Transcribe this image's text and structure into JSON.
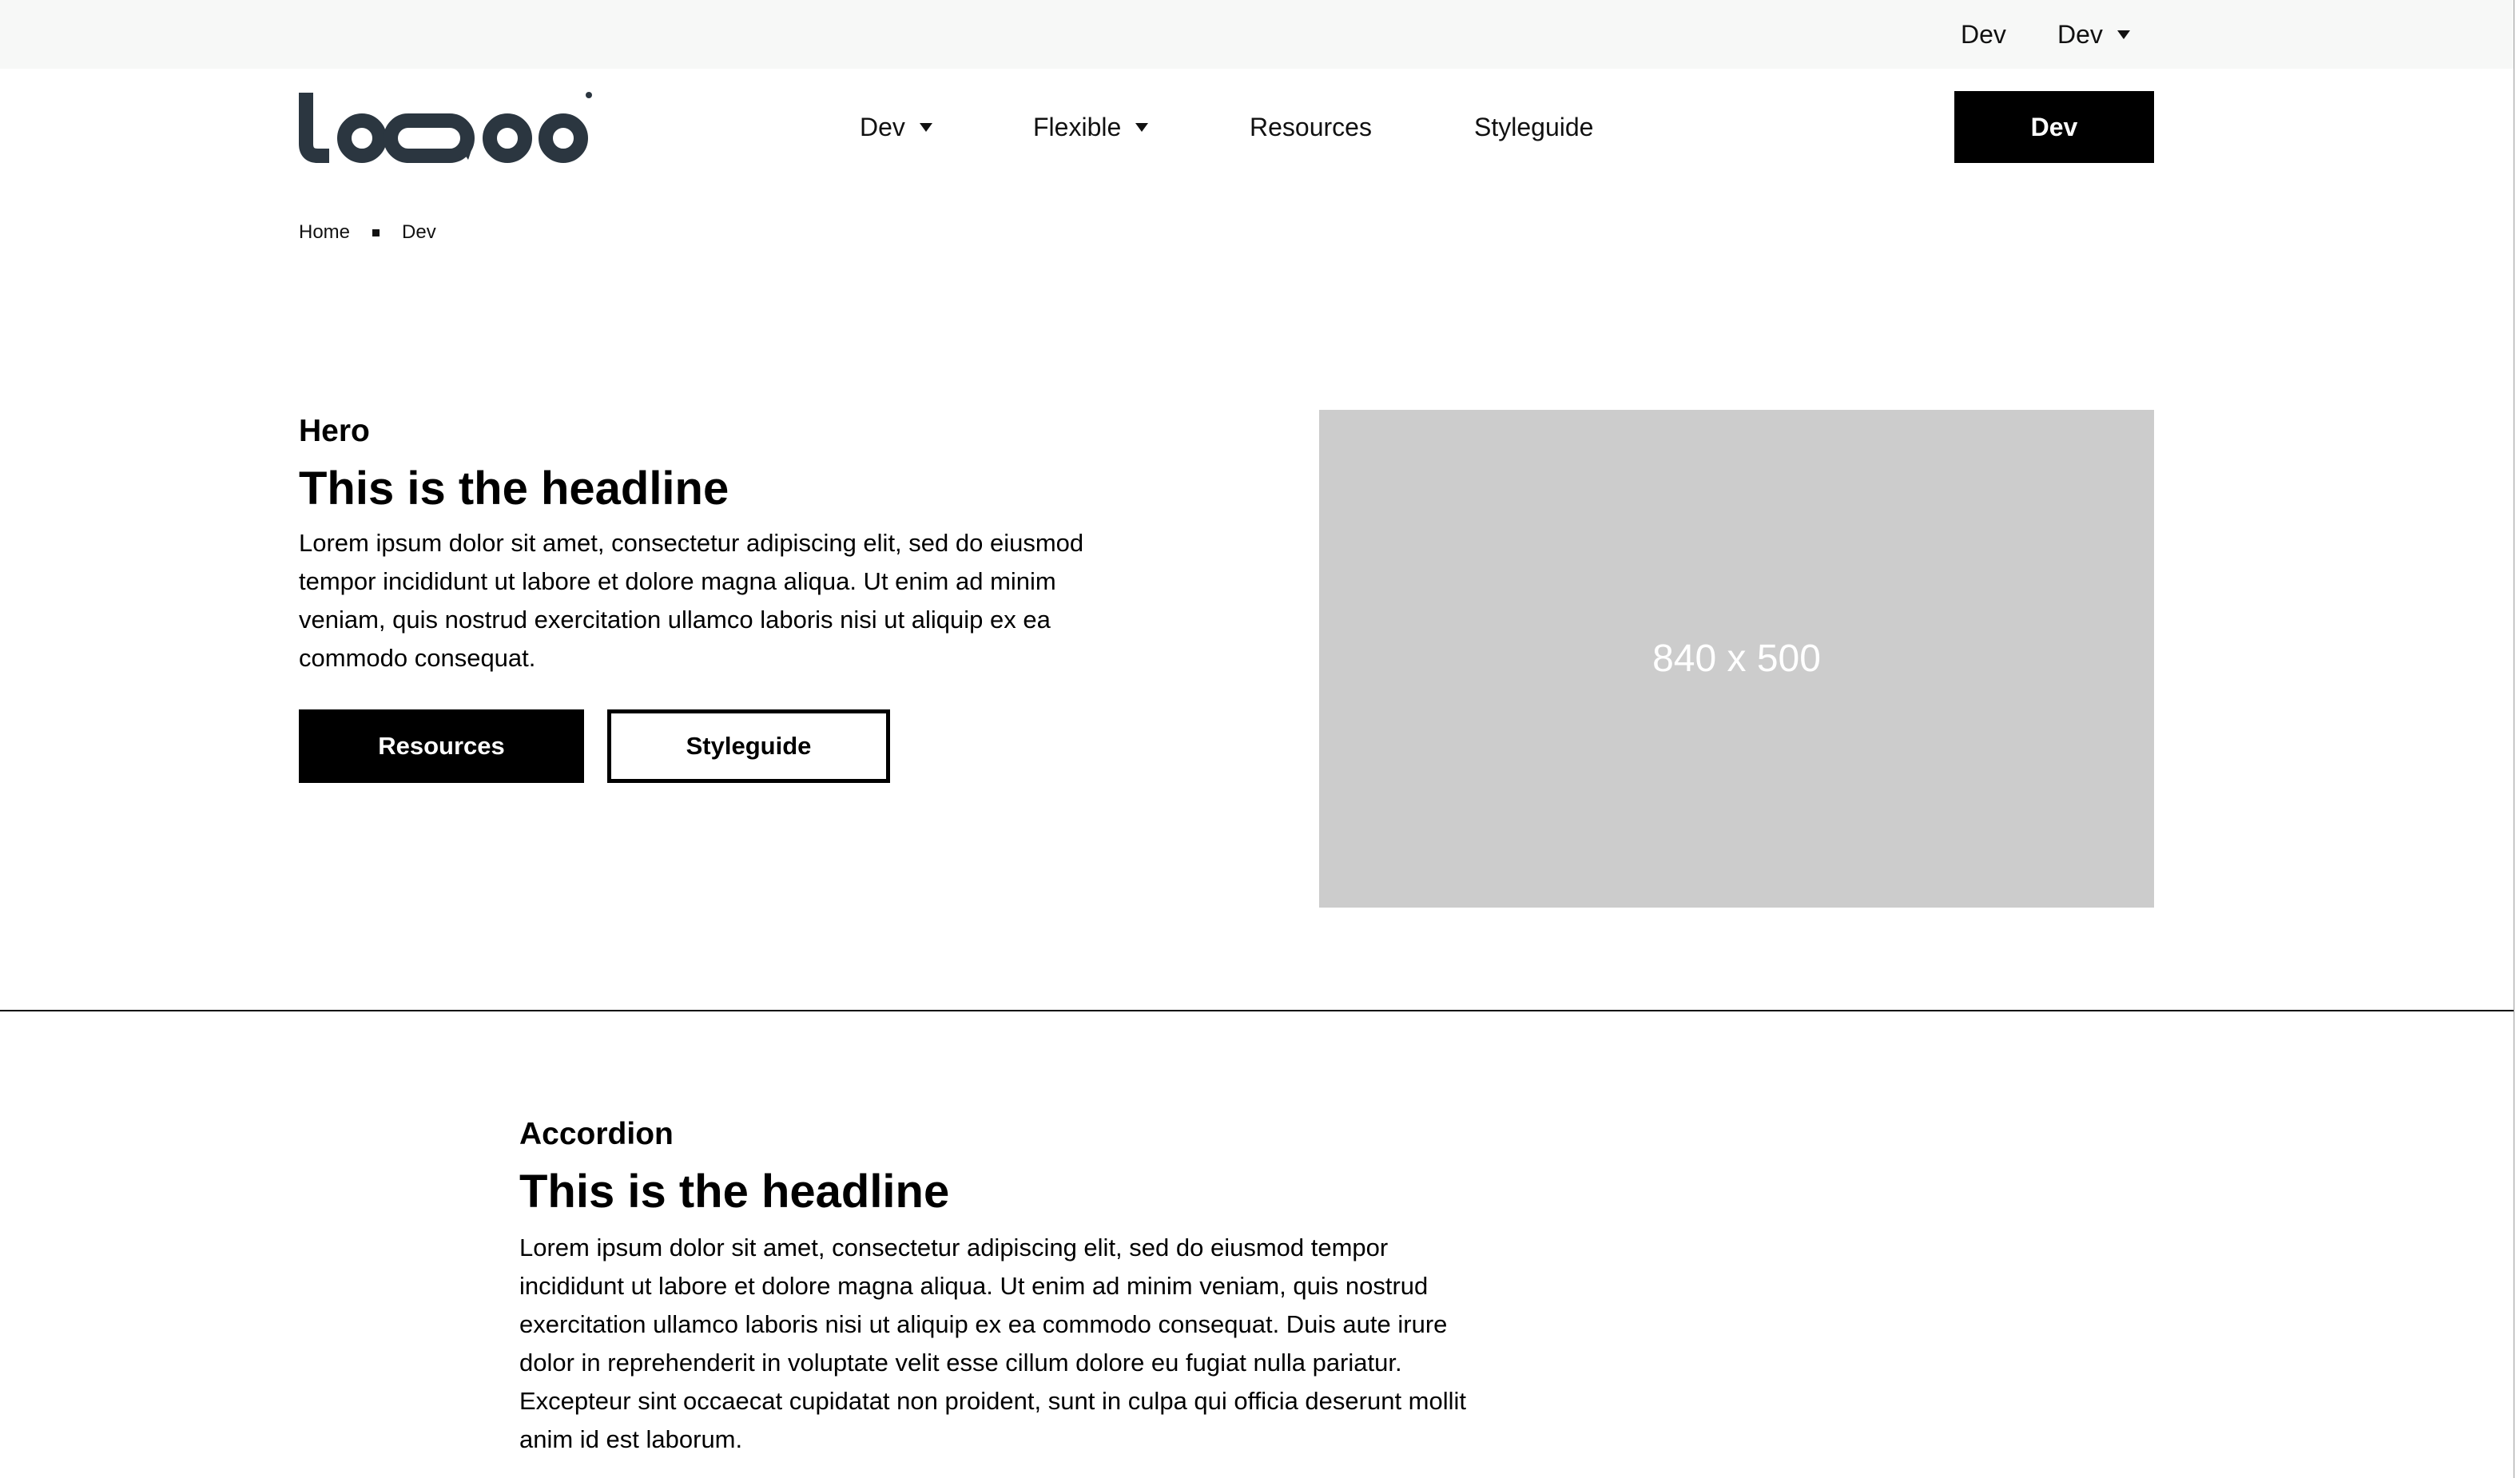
{
  "topbar": {
    "link_label": "Dev",
    "dropdown_label": "Dev"
  },
  "header": {
    "logo_alt": "LOGO",
    "nav": [
      {
        "label": "Dev",
        "has_dropdown": true
      },
      {
        "label": "Flexible",
        "has_dropdown": true
      },
      {
        "label": "Resources",
        "has_dropdown": false
      },
      {
        "label": "Styleguide",
        "has_dropdown": false
      }
    ],
    "cta_label": "Dev"
  },
  "breadcrumb": {
    "items": [
      "Home",
      "Dev"
    ]
  },
  "hero": {
    "eyebrow": "Hero",
    "headline": "This is the headline",
    "body": "Lorem ipsum dolor sit amet, consectetur adipiscing elit, sed do eiusmod tempor incididunt ut labore et dolore magna aliqua. Ut enim ad minim veniam, quis nostrud exercitation ullamco laboris nisi ut aliquip ex ea commodo consequat.",
    "primary_button": "Resources",
    "secondary_button": "Styleguide",
    "image_label": "840 x 500"
  },
  "accordion": {
    "eyebrow": "Accordion",
    "headline": "This is the headline",
    "body": "Lorem ipsum dolor sit amet, consectetur adipiscing elit, sed do eiusmod tempor incididunt ut labore et dolore magna aliqua. Ut enim ad minim veniam, quis nostrud exercitation ullamco laboris nisi ut aliquip ex ea commodo consequat. Duis aute irure dolor in reprehenderit in voluptate velit esse cillum dolore eu fugiat nulla pariatur. Excepteur sint occaecat cupidatat non proident, sunt in culpa qui officia deserunt mollit anim id est laborum."
  },
  "colors": {
    "topbar_bg": "#f7f8f7",
    "logo": "#2b3640",
    "primary": "#000000",
    "placeholder_bg": "#cccccc",
    "placeholder_text": "#ffffff"
  },
  "icons": {
    "dropdown": "caret-down-icon",
    "breadcrumb_separator": "square-bullet-icon"
  }
}
